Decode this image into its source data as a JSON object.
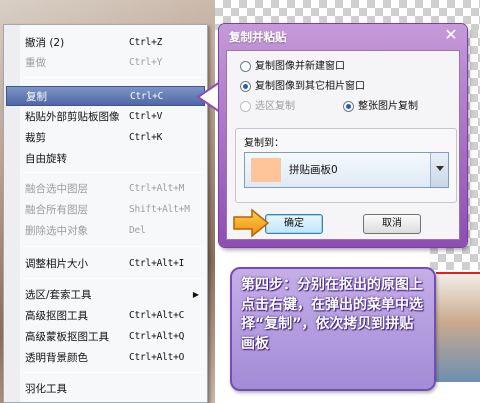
{
  "context_menu": {
    "items": [
      {
        "label": "撤消 (2)",
        "shortcut": "Ctrl+Z",
        "disabled": false
      },
      {
        "label": "重做",
        "shortcut": "Ctrl+Y",
        "disabled": true
      },
      {
        "label": "复制",
        "shortcut": "Ctrl+C",
        "disabled": false,
        "selected": true
      },
      {
        "label": "粘贴外部剪贴板图像",
        "shortcut": "Ctrl+V",
        "disabled": false
      },
      {
        "label": "裁剪",
        "shortcut": "Ctrl+K",
        "disabled": false
      },
      {
        "label": "自由旋转",
        "shortcut": "",
        "disabled": false
      },
      {
        "label": "融合选中图层",
        "shortcut": "Ctrl+Alt+M",
        "disabled": true
      },
      {
        "label": "融合所有图层",
        "shortcut": "Shift+Alt+M",
        "disabled": true
      },
      {
        "label": "删除选中对象",
        "shortcut": "Del",
        "disabled": true
      },
      {
        "label": "调整相片大小",
        "shortcut": "Ctrl+Alt+I",
        "disabled": false
      },
      {
        "label": "选区/套索工具",
        "shortcut": "",
        "disabled": false,
        "submenu": true
      },
      {
        "label": "高级抠图工具",
        "shortcut": "Ctrl+Alt+C",
        "disabled": false
      },
      {
        "label": "高级蒙板抠图工具",
        "shortcut": "Ctrl+Alt+Q",
        "disabled": false
      },
      {
        "label": "透明背景颜色",
        "shortcut": "Ctrl+Alt+O",
        "disabled": false
      },
      {
        "label": "羽化工具",
        "shortcut": "",
        "disabled": false
      }
    ],
    "submenu_arrow": "▶"
  },
  "dialog": {
    "title": "复制并粘贴",
    "close_glyph": "✕",
    "options": {
      "new_window": "复制图像并新建窗口",
      "other_window": "复制图像到其它相片窗口",
      "selected_area": "选区复制",
      "whole_image": "整张图片复制"
    },
    "selected_option": "other_window",
    "selected_scope": "whole_image",
    "copy_to_label": "复制到：",
    "copy_to_value": "拼贴画板0",
    "copy_to_swatch_color": "#ffc59a",
    "ok_label": "确定",
    "cancel_label": "取消"
  },
  "note": {
    "text": "第四步：分别在抠出的原图上点击右键，在弹出的菜单中选择“复制”，依次拷贝到拼贴画板"
  },
  "colors": {
    "dialog_purple": "#8e4db2",
    "menu_highlight": "#4f67a6",
    "note_purple": "#a38bd6",
    "arrow_orange": "#f59a1b"
  }
}
